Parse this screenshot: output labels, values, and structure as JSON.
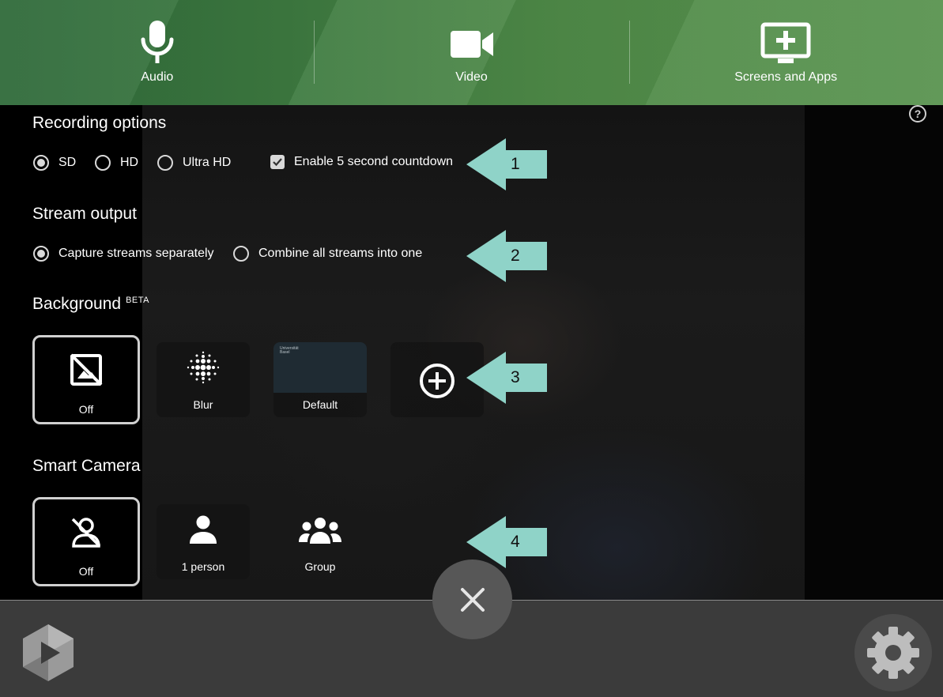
{
  "topbar": {
    "audio_label": "Audio",
    "video_label": "Video",
    "screens_label": "Screens and Apps"
  },
  "recording": {
    "title": "Recording options",
    "quality_options": [
      "SD",
      "HD",
      "Ultra HD"
    ],
    "selected_quality": "SD",
    "countdown_label": "Enable 5 second countdown",
    "countdown_checked": true
  },
  "stream": {
    "title": "Stream output",
    "options": [
      "Capture streams separately",
      "Combine all streams into one"
    ],
    "selected": "Capture streams separately"
  },
  "background": {
    "title": "Background",
    "badge": "BETA",
    "tiles": [
      "Off",
      "Blur",
      "Default"
    ],
    "selected": "Off",
    "default_preview_text": [
      "Universität",
      "Basel"
    ]
  },
  "smart_camera": {
    "title": "Smart Camera",
    "tiles": [
      "Off",
      "1 person",
      "Group"
    ],
    "selected": "Off"
  },
  "callouts": [
    "1",
    "2",
    "3",
    "4"
  ],
  "help_label": "?",
  "colors": {
    "topbar_green": "#4a8446",
    "callout_teal": "#8fd3c8",
    "bottombar": "#3b3b3b"
  },
  "icons": {
    "audio": "microphone-icon",
    "video": "video-camera-icon",
    "screens": "screen-plus-icon",
    "bg_off": "image-off-icon",
    "bg_blur": "blur-icon",
    "bg_add": "add-circle-icon",
    "cam_off": "person-off-icon",
    "cam_one": "person-icon",
    "cam_group": "group-icon",
    "close": "close-icon",
    "settings": "gear-icon",
    "logo": "panopto-logo-icon"
  }
}
